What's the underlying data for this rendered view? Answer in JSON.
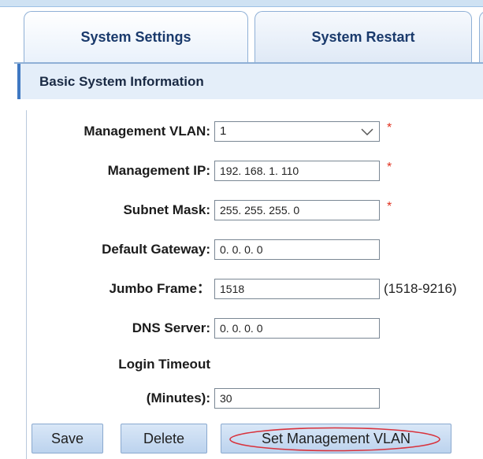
{
  "tabs": [
    {
      "label": "System Settings",
      "active": true
    },
    {
      "label": "System Restart",
      "active": false
    }
  ],
  "section": {
    "title": "Basic System Information"
  },
  "form": {
    "management_vlan": {
      "label": "Management VLAN:",
      "value": "1",
      "required": true
    },
    "management_ip": {
      "label": "Management IP:",
      "value": "192. 168. 1. 110",
      "required": true
    },
    "subnet_mask": {
      "label": "Subnet Mask:",
      "value": "255. 255. 255. 0",
      "required": true
    },
    "default_gateway": {
      "label": "Default Gateway:",
      "value": "0. 0. 0. 0"
    },
    "jumbo_frame": {
      "label": "Jumbo Frame：",
      "value": "1518",
      "hint": "(1518-9216)"
    },
    "dns_server": {
      "label": "DNS Server:",
      "value": "0. 0. 0. 0"
    },
    "login_timeout": {
      "label_line1": "Login Timeout",
      "label_line2": "(Minutes):",
      "value": "30"
    },
    "required_mark": "*"
  },
  "buttons": {
    "save": "Save",
    "delete": "Delete",
    "set_vlan": "Set Management VLAN"
  },
  "colors": {
    "accent": "#3f78c2",
    "required": "#e0301e",
    "highlight_oval": "#d8323c"
  },
  "icons": {
    "dropdown": "chevron-down-icon"
  }
}
